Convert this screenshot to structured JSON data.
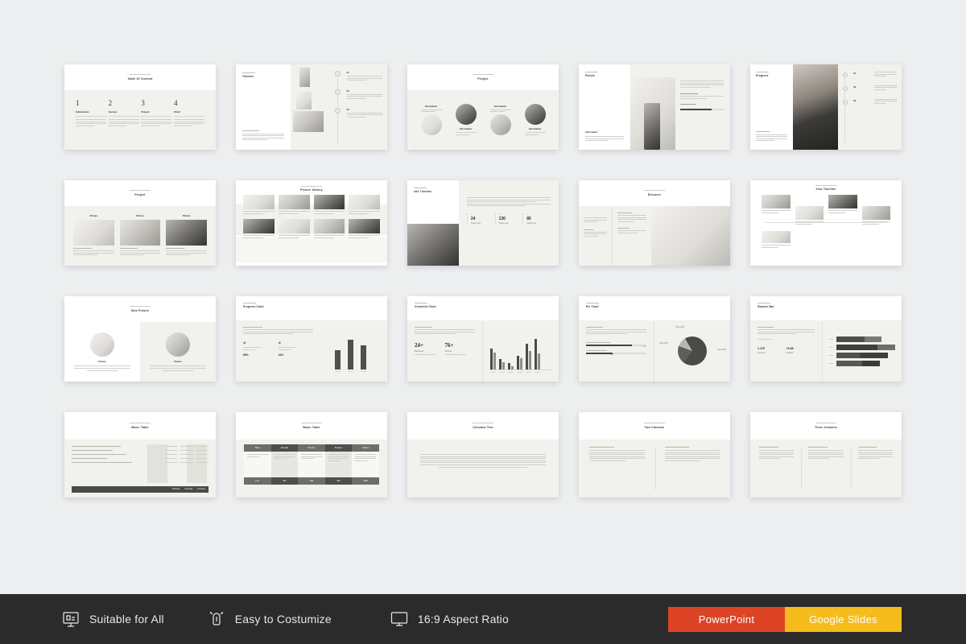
{
  "page": {
    "background": "#eceeef",
    "kind": "presentation-template-preview"
  },
  "slides": [
    {
      "id": 1,
      "title": "Table Of Content",
      "layout": "toc",
      "items": [
        {
          "num": "1",
          "label": "Information"
        },
        {
          "num": "2",
          "label": "Service"
        },
        {
          "num": "3",
          "label": "Project"
        },
        {
          "num": "4",
          "label": "Chart"
        }
      ]
    },
    {
      "id": 2,
      "title": "Timeline",
      "layout": "timeline-left-title",
      "steps": [
        "01",
        "02",
        "03"
      ]
    },
    {
      "id": 3,
      "title": "Project",
      "layout": "four-circles",
      "items": [
        "Information",
        "Information",
        "Information",
        "Information"
      ]
    },
    {
      "id": 4,
      "title": "Picture",
      "layout": "picture-split",
      "caption": "Information"
    },
    {
      "id": 5,
      "title": "Progress",
      "layout": "progress-photo",
      "steps": [
        "01",
        "02",
        "03"
      ]
    },
    {
      "id": 6,
      "title": "Project",
      "layout": "three-cards",
      "items": [
        "Picture",
        "Picture",
        "Picture"
      ]
    },
    {
      "id": 7,
      "title": "Picture Gallery",
      "layout": "gallery-2x4"
    },
    {
      "id": 8,
      "title": "Info Timeline",
      "layout": "info-stats",
      "stats": [
        {
          "value": "24",
          "label": "Total Line"
        },
        {
          "value": "130",
          "label": "Total Line"
        },
        {
          "value": "85",
          "label": "Total Line"
        }
      ]
    },
    {
      "id": 9,
      "title": "Discover",
      "layout": "discover-photo"
    },
    {
      "id": 10,
      "title": "Year Timeline",
      "layout": "year-grid"
    },
    {
      "id": 11,
      "title": "Side Picture",
      "layout": "two-circle-split",
      "items": [
        "Picture",
        "Picture"
      ]
    },
    {
      "id": 12,
      "title": "Progress Chart",
      "layout": "progress-chart",
      "stats": [
        {
          "value": "65%",
          "label": "Information"
        },
        {
          "value": "24%",
          "label": "Information"
        }
      ]
    },
    {
      "id": 13,
      "title": "Clustered Chart",
      "layout": "clustered-chart",
      "stats": [
        {
          "value": "24+",
          "label": "Business"
        },
        {
          "value": "76+",
          "label": "Clients"
        }
      ]
    },
    {
      "id": 14,
      "title": "Pie Chart",
      "layout": "pie-chart",
      "bars": [
        {
          "label": "Information",
          "value": "65%"
        },
        {
          "label": "Information",
          "value": "32%"
        }
      ],
      "slice_labels": [
        "Total 24%",
        "Total 16%",
        "Total 60%"
      ]
    },
    {
      "id": 15,
      "title": "Stacked Bar",
      "layout": "stacked-bar",
      "stats": [
        {
          "value": "1.475",
          "label": "Income"
        },
        {
          "value": "+8.86",
          "label": "Growth"
        }
      ]
    },
    {
      "id": 16,
      "title": "Basic Table",
      "layout": "table-rows",
      "footer_cells": [
        "Purchase",
        "Purchase",
        "Purchase"
      ]
    },
    {
      "id": 17,
      "title": "Basic Table",
      "layout": "table-columns",
      "headers": [
        "Basic",
        "Standard",
        "Premium",
        "Business",
        "Advance"
      ],
      "footer_cells": [
        "Free",
        "$29",
        "$49",
        "$99",
        "$149"
      ]
    },
    {
      "id": 18,
      "title": "Columns Text",
      "layout": "one-column"
    },
    {
      "id": 19,
      "title": "Two Columns",
      "layout": "two-columns"
    },
    {
      "id": 20,
      "title": "Three Columns",
      "layout": "three-columns"
    }
  ],
  "footer": {
    "features": [
      {
        "icon": "presentation-board-icon",
        "label": "Suitable for All"
      },
      {
        "icon": "customize-tool-icon",
        "label": "Easy to Costumize"
      },
      {
        "icon": "monitor-icon",
        "label": "16:9 Aspect Ratio"
      }
    ],
    "buttons": [
      {
        "label": "PowerPoint",
        "color": "#dd4425",
        "name": "powerpoint-button"
      },
      {
        "label": "Google Slides",
        "color": "#f5bc1c",
        "name": "google-slides-button"
      }
    ],
    "background": "#2b2b2b"
  }
}
